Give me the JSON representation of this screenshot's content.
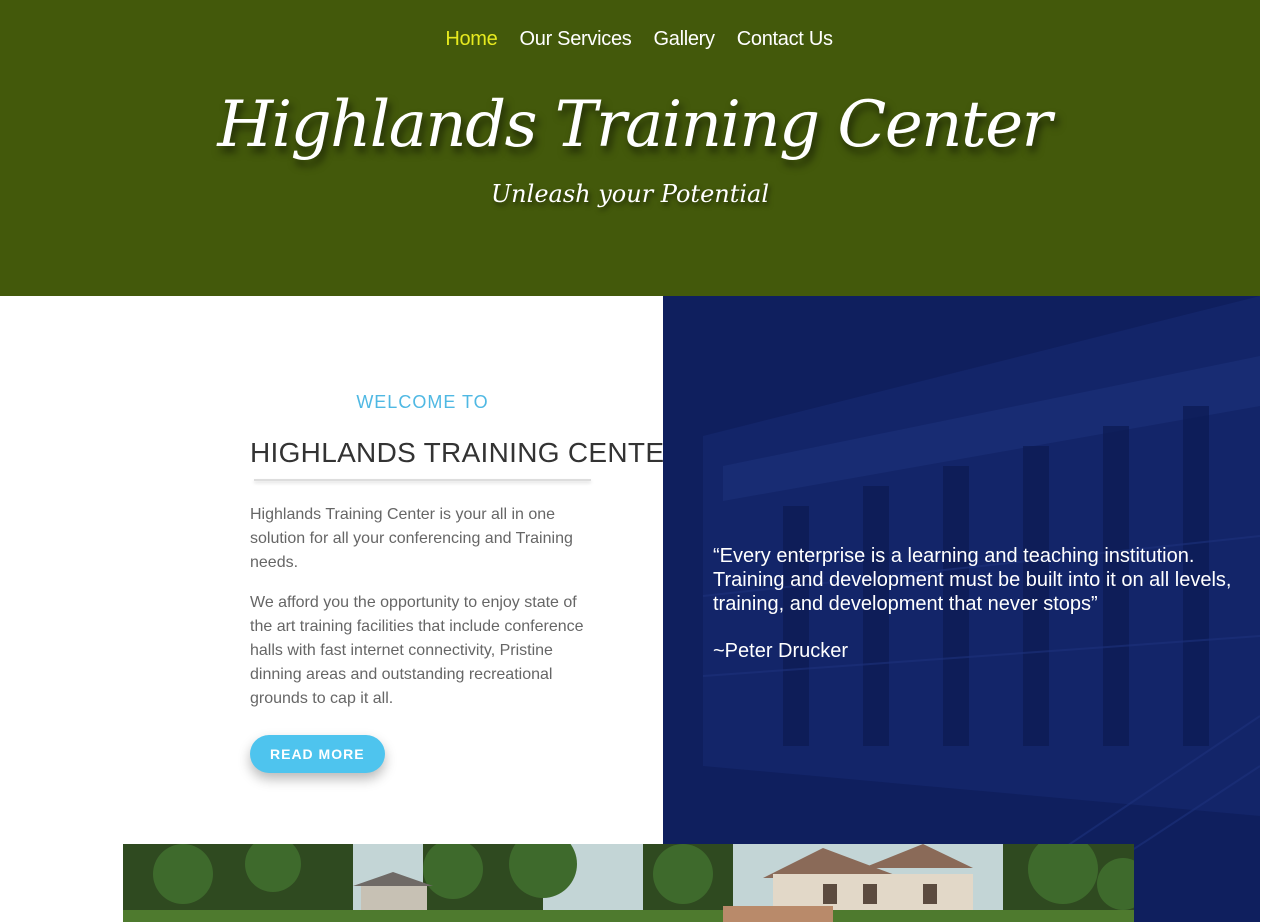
{
  "nav": {
    "items": [
      {
        "label": "Home",
        "active": true
      },
      {
        "label": "Our Services",
        "active": false
      },
      {
        "label": "Gallery",
        "active": false
      },
      {
        "label": "Contact Us",
        "active": false
      }
    ]
  },
  "header": {
    "title": "Highlands Training Center",
    "tagline": "Unleash your Potential"
  },
  "welcome": {
    "kicker": "WELCOME TO",
    "heading": "HIGHLANDS TRAINING CENTER",
    "paragraph1": "Highlands Training Center is your all in one solution for all your conferencing and Training needs.",
    "paragraph2": "We afford you the opportunity to enjoy state of the art training facilities that include conference halls with fast internet connectivity, Pristine dinning areas and outstanding recreational grounds to cap it all.",
    "button_label": "READ MORE"
  },
  "quote": {
    "text": "“Every enterprise is a learning and teaching institution. Training and development must be built into it on all levels, training, and development that never stops”",
    "author": "~Peter Drucker"
  },
  "colors": {
    "header_bg": "#43590b",
    "nav_active": "#e7ea1f",
    "accent_blue": "#4fb8e3",
    "button_bg": "#4ec4ee",
    "quote_panel_bg": "#0f1f5e"
  }
}
